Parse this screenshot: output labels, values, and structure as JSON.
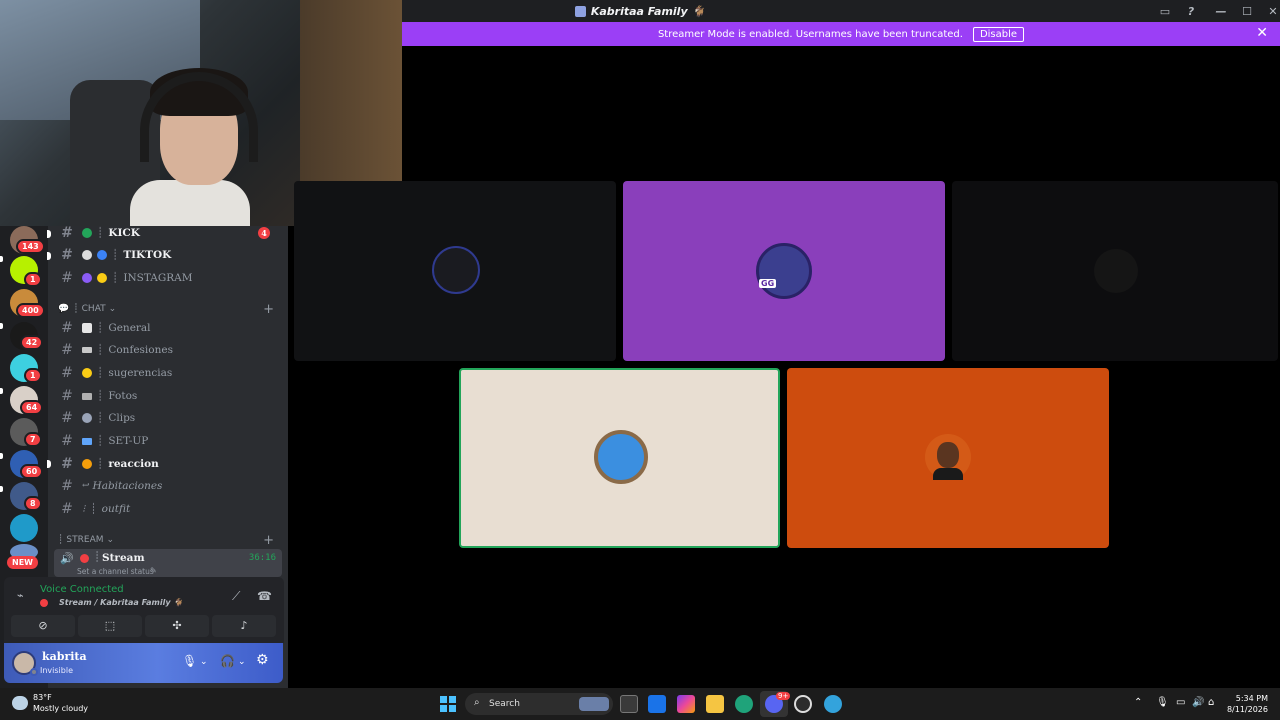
{
  "window": {
    "title": "Kabritaa Family 🐐",
    "controls": [
      "—",
      "☐",
      "✕"
    ]
  },
  "streamer_banner": {
    "text": "Streamer Mode is enabled. Usernames have been truncated.",
    "button": "Disable",
    "close": "✕"
  },
  "rail": {
    "badges": [
      "143",
      "1",
      "400",
      "42",
      "1",
      "64",
      "7",
      "60",
      "8"
    ],
    "new": "NEW"
  },
  "channels": {
    "top": [
      {
        "name": "KICK",
        "sep": "┊",
        "unread": true,
        "mention": "4"
      },
      {
        "name": "TIKTOK",
        "sep": "┊",
        "unread": true
      },
      {
        "name": "INSTAGRAM",
        "sep": "┊",
        "unread": false
      }
    ],
    "chat_category": "CHAT",
    "chat": [
      {
        "name": "General",
        "sep": "┊",
        "unread": false
      },
      {
        "name": "Confesiones",
        "sep": "┊",
        "unread": false
      },
      {
        "name": "sugerencias",
        "sep": "┊",
        "unread": false
      },
      {
        "name": "Fotos",
        "sep": "┊",
        "unread": false
      },
      {
        "name": "Clips",
        "sep": "┊",
        "unread": false
      },
      {
        "name": "SET-UP",
        "sep": "┊",
        "unread": false
      },
      {
        "name": "reaccion",
        "sep": "┊",
        "unread": true
      },
      {
        "name": "Habitaciones",
        "sep": "",
        "unread": false
      },
      {
        "name": "outfit",
        "sep": "┊",
        "unread": false
      }
    ],
    "stream_category": "STREAM",
    "voice_channel": {
      "name": "Stream",
      "sep": "┊",
      "status": "Set a channel status",
      "timer": "36:16"
    }
  },
  "voice_panel": {
    "status": "Voice Connected",
    "location": "Stream / Kabritaa Family 🐐"
  },
  "user_panel": {
    "name": "kabrita",
    "status": "Invisible"
  },
  "taskbar": {
    "temp": "83°F",
    "weather": "Mostly cloudy",
    "search": "Search",
    "time": "5:34 PM",
    "date": "8/11/2026",
    "discord_badge": "9+"
  }
}
